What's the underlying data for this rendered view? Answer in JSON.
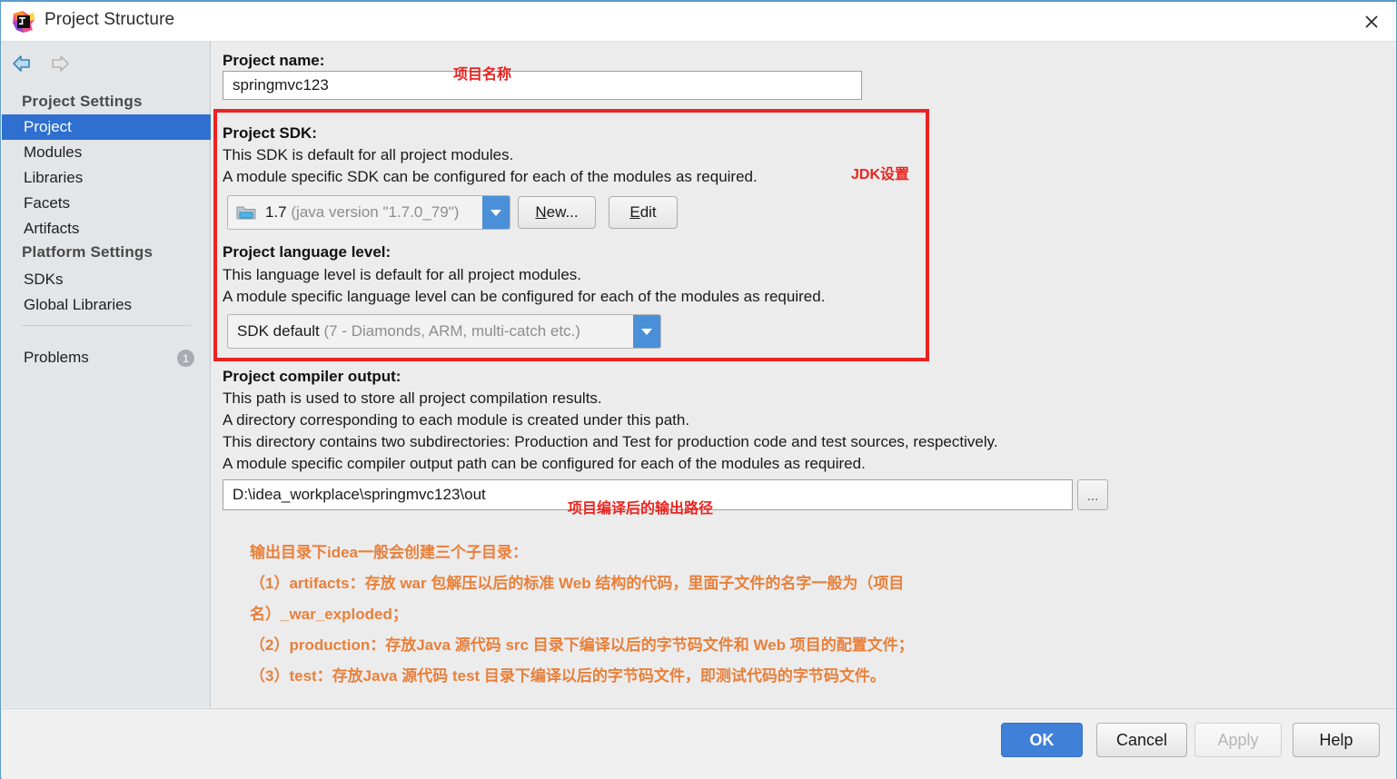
{
  "window": {
    "title": "Project Structure",
    "app_icon": "intellij-idea-icon",
    "close_icon": "close-icon"
  },
  "sidebar": {
    "nav": {
      "back_icon": "arrow-left-icon",
      "forward_icon": "arrow-right-icon"
    },
    "groups": [
      {
        "header": "Project Settings",
        "items": [
          {
            "label": "Project",
            "selected": true
          },
          {
            "label": "Modules",
            "selected": false
          },
          {
            "label": "Libraries",
            "selected": false
          },
          {
            "label": "Facets",
            "selected": false
          },
          {
            "label": "Artifacts",
            "selected": false
          }
        ]
      },
      {
        "header": "Platform Settings",
        "items": [
          {
            "label": "SDKs",
            "selected": false
          },
          {
            "label": "Global Libraries",
            "selected": false
          }
        ]
      }
    ],
    "problems": {
      "label": "Problems",
      "count": "1"
    }
  },
  "main": {
    "project_name": {
      "label": "Project name:",
      "value": "springmvc123",
      "placeholder": ""
    },
    "project_sdk": {
      "label": "Project SDK:",
      "desc1": "This SDK is default for all project modules.",
      "desc2": "A module specific SDK can be configured for each of the modules as required.",
      "combo_main": "1.7",
      "combo_detail": "(java version \"1.7.0_79\")",
      "combo_icon": "sdk-folder-icon",
      "dropdown_icon": "chevron-down-icon",
      "new_button": "New...",
      "new_button_mnemonic": "N",
      "edit_button": "Edit",
      "edit_button_mnemonic": "E"
    },
    "language_level": {
      "label": "Project language level:",
      "desc1": "This language level is default for all project modules.",
      "desc2": "A module specific language level can be configured for each of the modules as required.",
      "combo_main": "SDK default",
      "combo_detail": "(7 - Diamonds, ARM, multi-catch etc.)",
      "dropdown_icon": "chevron-down-icon"
    },
    "compiler_output": {
      "label": "Project compiler output:",
      "desc1": "This path is used to store all project compilation results.",
      "desc2": "A directory corresponding to each module is created under this path.",
      "desc3": "This directory contains two subdirectories: Production and Test for production code and test sources, respectively.",
      "desc4": "A module specific compiler output path can be configured for each of the modules as required.",
      "value": "D:\\idea_workplace\\springmvc123\\out",
      "browse_button": "...",
      "browse_icon": "ellipsis-icon"
    }
  },
  "annotations": {
    "project_name_note": "项目名称",
    "jdk_note": "JDK设置",
    "compiler_output_note": "项目编译后的输出路径",
    "notes_color_red": "#e8241f",
    "notes_color_orange": "#e8803a",
    "highlight_box_color": "#ee2222",
    "orange_notes": [
      "输出目录下idea一般会创建三个子目录：",
      "（1）artifacts：存放 war 包解压以后的标准 Web 结构的代码，里面子文件的名字一般为（项目",
      "名）_war_exploded；",
      "（2）production：存放Java 源代码 src 目录下编译以后的字节码文件和 Web 项目的配置文件；",
      "（3）test：存放Java 源代码 test 目录下编译以后的字节码文件，即测试代码的字节码文件。"
    ]
  },
  "footer": {
    "ok": "OK",
    "cancel": "Cancel",
    "apply": "Apply",
    "help": "Help",
    "ok_color": "#4080d8"
  }
}
